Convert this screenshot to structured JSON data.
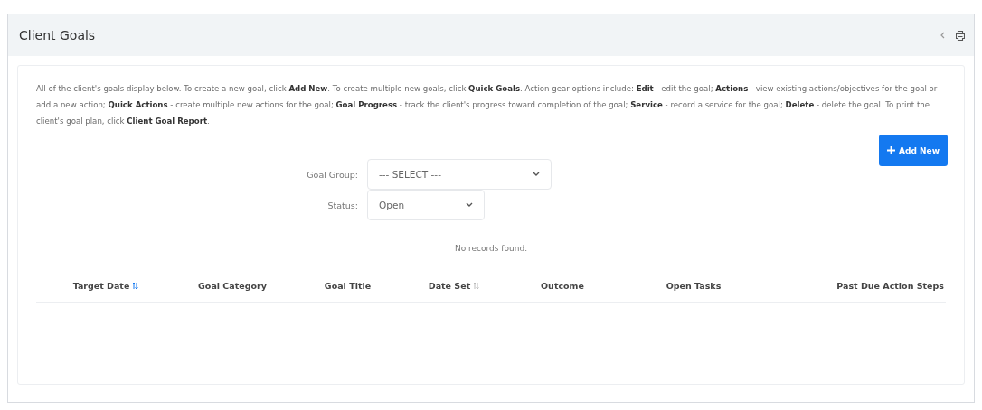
{
  "panel": {
    "title": "Client Goals"
  },
  "instructions": "All of the client's goals display below. To create a new goal, click **Add New**. To create multiple new goals, click **Quick Goals**.  Action gear options include: **Edit** - edit the goal; **Actions** - view existing actions/objectives for the goal or add a new action; **Quick Actions** - create multiple new actions for the goal; **Goal Progress** - track the client's progress toward completion of the goal; **Service** - record a service for the goal; **Delete** - delete the goal.  To print the client's goal plan, click **Client Goal Report**.",
  "add_button": {
    "label": "Add New"
  },
  "filters": [
    {
      "label": "Goal Group:",
      "value": "--- SELECT ---",
      "kind": "wide"
    },
    {
      "label": "Status:",
      "value": "Open",
      "kind": "narrow"
    }
  ],
  "empty_message": "No records found.",
  "table": {
    "columns": [
      {
        "label": "Target Date",
        "kind": "sortable",
        "sorted": true
      },
      {
        "label": "Goal Category",
        "kind": "plain"
      },
      {
        "label": "Goal Title",
        "kind": "plain"
      },
      {
        "label": "Date Set",
        "kind": "sortable",
        "sorted": false
      },
      {
        "label": "Outcome",
        "kind": "plain"
      },
      {
        "label": "Open Tasks",
        "kind": "plain"
      },
      {
        "label": "Past Due Action Steps",
        "kind": "plain"
      }
    ]
  }
}
